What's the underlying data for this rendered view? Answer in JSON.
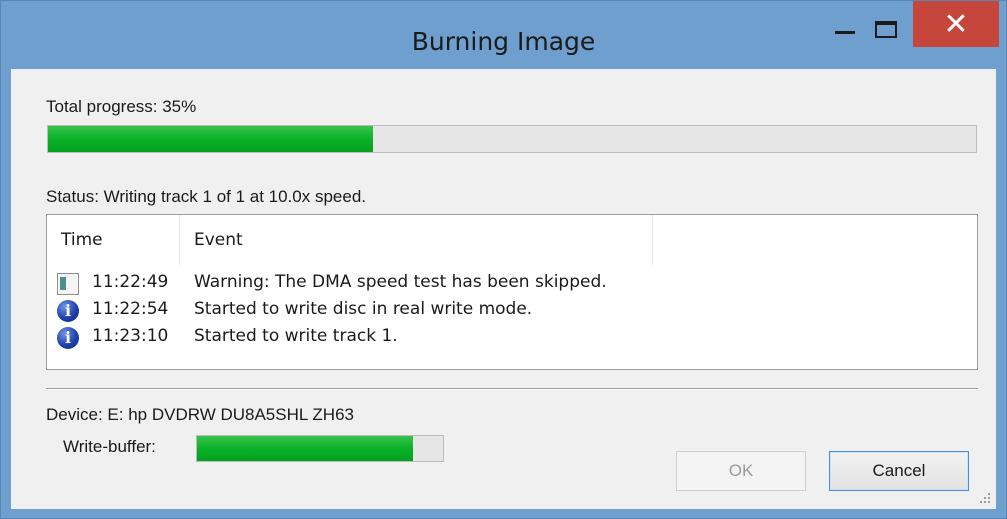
{
  "window": {
    "title": "Burning Image",
    "controls": {
      "minimize_icon": "minimize-icon",
      "maximize_icon": "maximize-icon",
      "close_glyph": "✕"
    }
  },
  "total_progress": {
    "label": "Total progress: 35%",
    "percent": 35
  },
  "status": {
    "text": "Status: Writing track 1 of 1 at 10.0x speed."
  },
  "log": {
    "columns": [
      "Time",
      "Event",
      ""
    ],
    "rows": [
      {
        "icon": "drive-icon",
        "time": "11:22:49",
        "event": "Warning: The DMA speed test has been skipped."
      },
      {
        "icon": "info-icon",
        "time": "11:22:54",
        "event": "Started to write disc in real write mode."
      },
      {
        "icon": "info-icon",
        "time": "11:23:10",
        "event": "Started to write track 1."
      }
    ]
  },
  "device": {
    "label": "Device: E: hp DVDRW  DU8A5SHL ZH63"
  },
  "write_buffer": {
    "label": "Write-buffer:",
    "percent": 88
  },
  "buttons": {
    "ok": "OK",
    "cancel": "Cancel"
  },
  "colors": {
    "titlebar": "#6f9fcf",
    "close_button": "#c7463b",
    "progress_fill": "#06b025",
    "dialog_background": "#f0f0f0"
  }
}
